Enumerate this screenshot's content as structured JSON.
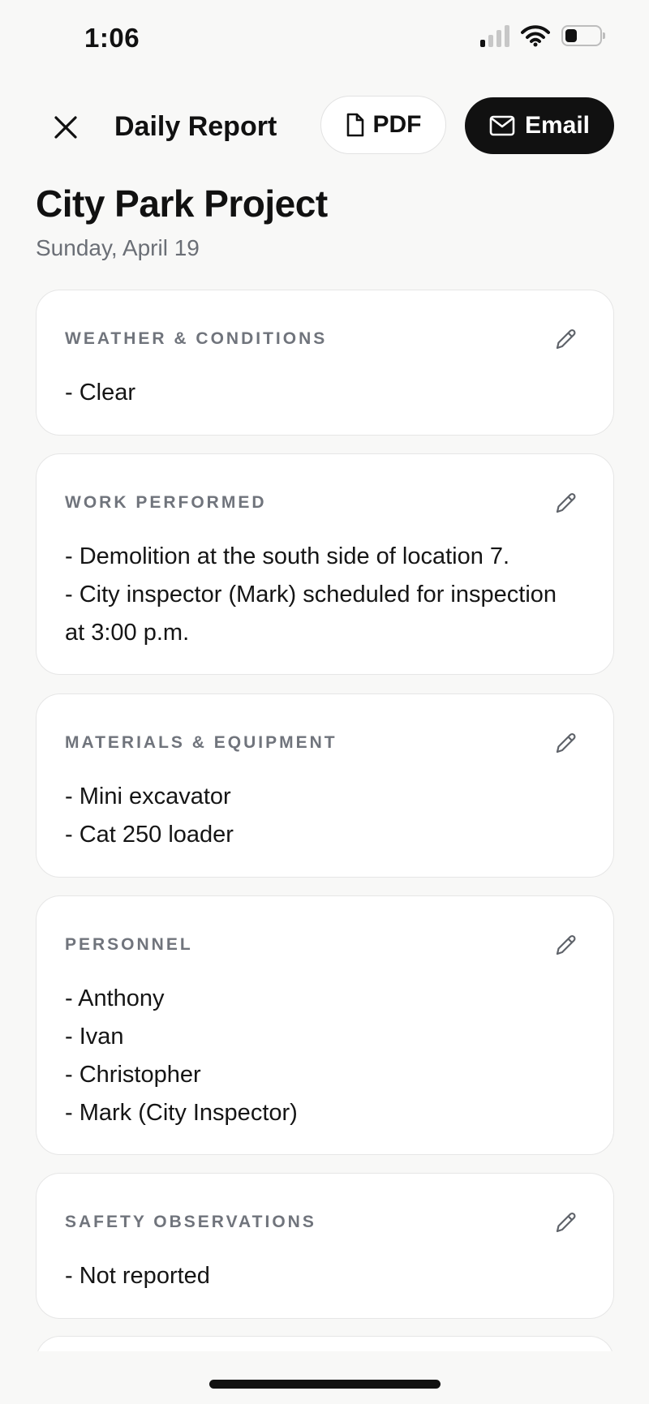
{
  "status_bar": {
    "time": "1:06",
    "signal_bars_active": 1,
    "signal_bars_total": 4,
    "battery_level": 0.35
  },
  "topbar": {
    "title": "Daily Report",
    "close_icon": "close-icon",
    "pdf_label": "PDF",
    "pdf_icon": "document-icon",
    "email_label": "Email",
    "email_icon": "mail-icon"
  },
  "report": {
    "project": "City Park Project",
    "date": "Sunday, April 19"
  },
  "sections": [
    {
      "heading": "WEATHER & CONDITIONS",
      "lines": [
        "- Clear"
      ]
    },
    {
      "heading": "WORK PERFORMED",
      "lines": [
        "- Demolition at the south side of location 7.",
        "- City inspector (Mark) scheduled for inspection at 3:00 p.m."
      ]
    },
    {
      "heading": "MATERIALS & EQUIPMENT",
      "lines": [
        "- Mini excavator",
        "- Cat 250 loader"
      ]
    },
    {
      "heading": "PERSONNEL",
      "lines": [
        "- Anthony",
        "- Ivan",
        "- Christopher",
        "- Mark (City Inspector)"
      ]
    },
    {
      "heading": "SAFETY OBSERVATIONS",
      "lines": [
        "- Not reported"
      ]
    }
  ],
  "colors": {
    "background": "#f8f8f7",
    "card": "#ffffff",
    "heading_gray": "#70747c",
    "primary_button": "#111111"
  }
}
